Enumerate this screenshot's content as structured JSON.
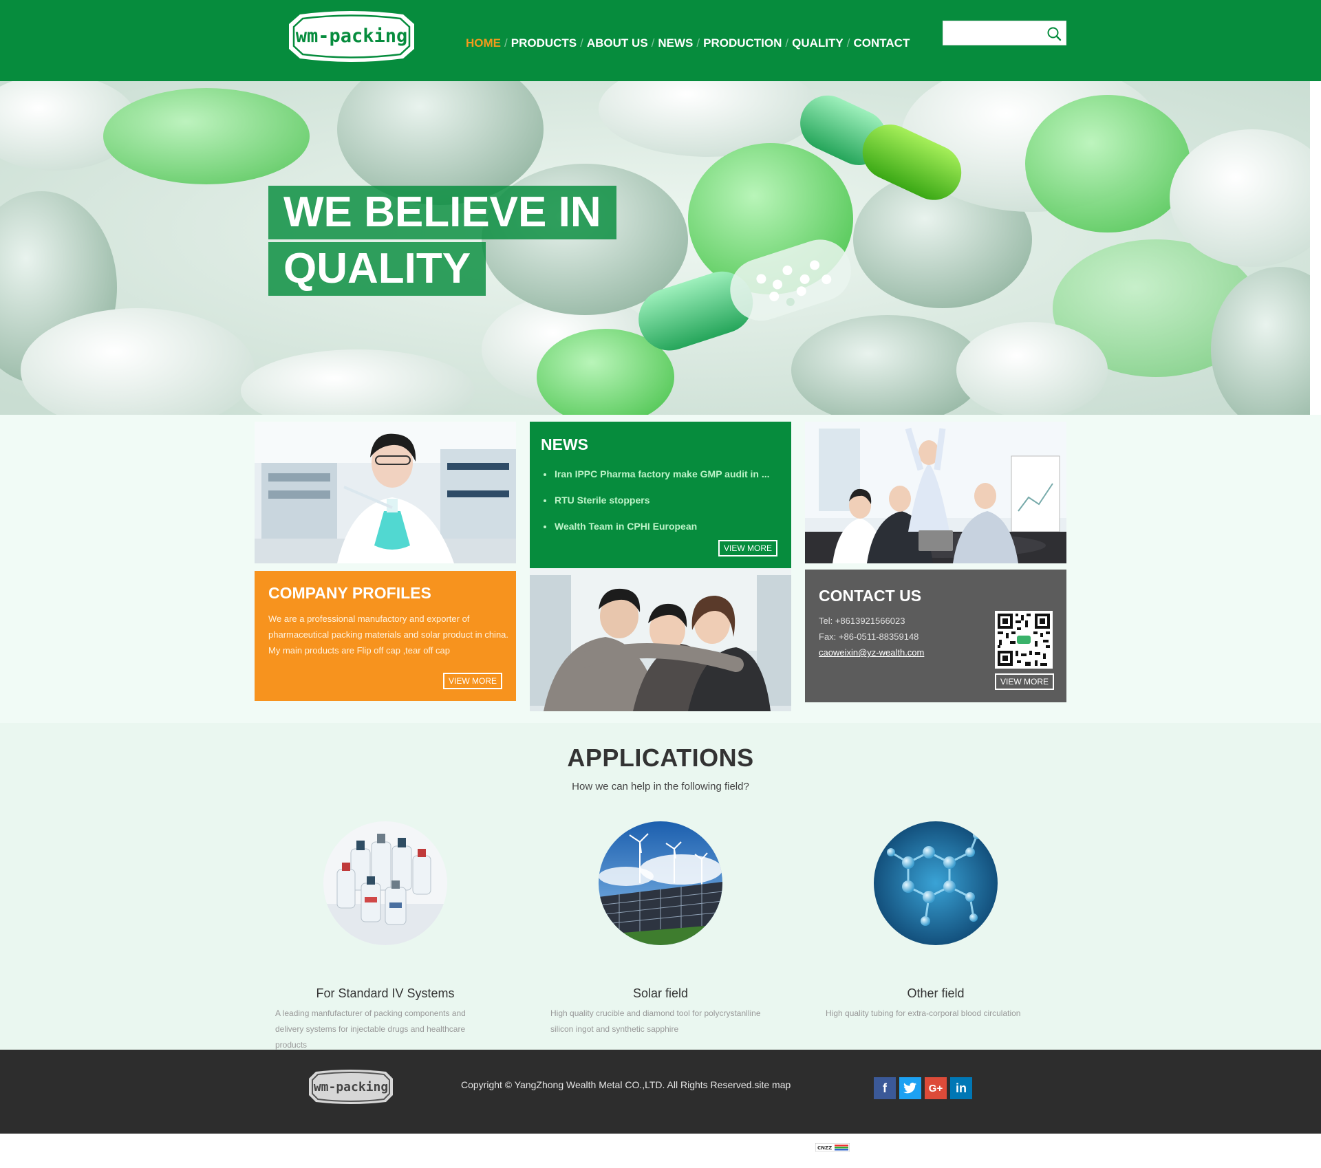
{
  "header": {
    "logo_text": "wm-packing",
    "nav": [
      "HOME",
      "PRODUCTS",
      "ABOUT US",
      "NEWS",
      "PRODUCTION",
      "QUALITY",
      "CONTACT"
    ],
    "nav_separator": "/",
    "active_nav": "HOME",
    "search": {
      "value": "",
      "placeholder": ""
    },
    "colors": {
      "bar": "#068c3d",
      "active": "#f39a1d"
    }
  },
  "hero": {
    "line1": "WE BELIEVE IN",
    "line2": "QUALITY"
  },
  "news": {
    "title": "NEWS",
    "items": [
      "Iran IPPC Pharma factory make GMP audit in ...",
      "RTU Sterile stoppers",
      "Wealth Team in CPHI European"
    ],
    "button": "VIEW MORE"
  },
  "profile": {
    "title": "COMPANY PROFILES",
    "text": "We are a professional manufactory and exporter of pharmaceutical packing materials and solar product in china. My main products are Flip off cap ,tear off cap",
    "button": "VIEW MORE"
  },
  "contact": {
    "title": "CONTACT US",
    "tel": "Tel: +8613921566023",
    "fax": "Fax: +86-0511-88359148",
    "email": "caoweixin@yz-wealth.com",
    "button": "VIEW MORE"
  },
  "applications": {
    "title": "APPLICATIONS",
    "subtitle": "How we can help in the following field?",
    "items": [
      {
        "title": "For Standard IV Systems",
        "desc": "A leading manfufacturer of packing components and delivery systems for injectable drugs and healthcare products",
        "icon": "iv-bottles-image"
      },
      {
        "title": "Solar field",
        "desc": "High quality crucible and diamond tool for polycrystanlline silicon ingot and synthetic sapphire",
        "icon": "solar-panels-image"
      },
      {
        "title": "Other field",
        "desc": "High quality tubing for extra-corporal blood circulation",
        "icon": "molecule-image"
      }
    ]
  },
  "footer": {
    "logo_text": "wm-packing",
    "copyright": "Copyright © YangZhong Wealth Metal CO.,LTD.  All Rights Reserved.site map",
    "social": [
      "f",
      "t",
      "G+",
      "in"
    ]
  },
  "badge": "CNZZ"
}
